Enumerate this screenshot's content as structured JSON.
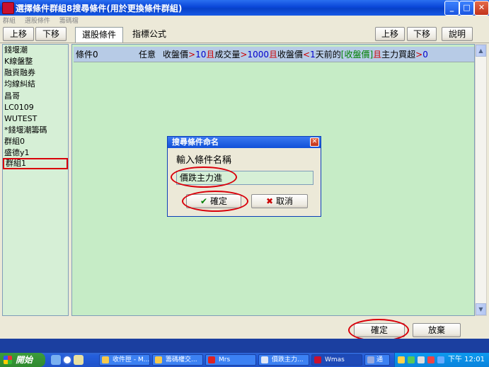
{
  "window": {
    "title": "選擇條件群組8搜尋條件(用於更換條件群組)",
    "menu": [
      "群組",
      "選股條件",
      "籌碼檔"
    ]
  },
  "toolbar": {
    "left_up": "上移",
    "left_down": "下移",
    "tab_select": "選股條件",
    "tab_formula": "指標公式",
    "right_up": "上移",
    "right_down": "下移",
    "help": "說明"
  },
  "groups": [
    {
      "label": "錢堰潮"
    },
    {
      "label": "K線盤整"
    },
    {
      "label": "融資融券"
    },
    {
      "label": "均線糾結"
    },
    {
      "label": "昌哥"
    },
    {
      "label": "LC0109"
    },
    {
      "label": "WUTEST"
    },
    {
      "label": "*錢堰潮籌碼"
    },
    {
      "label": "群組0"
    },
    {
      "label": "盛德y1"
    },
    {
      "label": "群組1"
    }
  ],
  "condition": {
    "name": "條件0",
    "mode": "任意",
    "t1": "收盤價",
    "op1": ">",
    "v1": "10",
    "and1": "且",
    "t2": "成交量",
    "op2": ">",
    "v2": "1000",
    "and2": "且",
    "t3": "收盤價",
    "op3": "<",
    "v3": "1",
    "t4": "天前的",
    "t5": "[收盤價]",
    "and3": "且",
    "t6": "主力買超",
    "op4": ">",
    "v4": "0"
  },
  "dialog": {
    "title": "搜尋條件命名",
    "prompt": "輸入條件名稱",
    "value": "價跌主力進",
    "ok_icon": "✔",
    "ok": "確定",
    "cancel_icon": "✖",
    "cancel": "取消"
  },
  "footer": {
    "ok": "確定",
    "cancel": "放棄"
  },
  "taskbar": {
    "start": "開始",
    "tasks": [
      "收件匣 - M...",
      "籌碼權交...",
      "Mrs",
      "價跌主力...",
      "Wmas"
    ],
    "tray_text": "通",
    "clock": "下午 12:01"
  },
  "colors": {
    "panel_green": "#c6ecc6",
    "list_green": "#d6efd6",
    "highlight_red": "#d9000b",
    "title_blue": "#0a46d8"
  }
}
